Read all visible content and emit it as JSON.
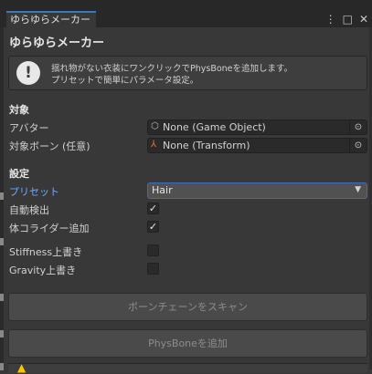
{
  "window": {
    "tab_title": "ゆらゆらメーカー",
    "menu_icon": "kebab-menu-icon",
    "maximize_icon": "maximize-icon",
    "close_icon": "close-icon"
  },
  "header": {
    "title": "ゆらゆらメーカー"
  },
  "help": {
    "icon": "info-icon",
    "line1": "揺れ物がない衣装にワンクリックでPhysBoneを追加します。",
    "line2": "プリセットで簡単にパラメータ設定。"
  },
  "target_section": {
    "heading": "対象",
    "avatar_label": "アバター",
    "avatar_value": "None (Game Object)",
    "bone_label": "対象ボーン (任意)",
    "bone_value": "None (Transform)"
  },
  "settings_section": {
    "heading": "設定",
    "preset_label": "プリセット",
    "preset_value": "Hair",
    "auto_detect_label": "自動検出",
    "auto_detect_checked": true,
    "body_collider_label": "体コライダー追加",
    "body_collider_checked": true,
    "stiffness_label": "Stiffness上書き",
    "stiffness_checked": false,
    "gravity_label": "Gravity上書き",
    "gravity_checked": false
  },
  "buttons": {
    "scan_label": "ボーンチェーンをスキャン",
    "add_label": "PhysBoneを追加"
  },
  "colors": {
    "background": "#383838",
    "accent": "#3a79bb",
    "preset_label": "#6ea8ff",
    "warning": "#ffc400"
  }
}
